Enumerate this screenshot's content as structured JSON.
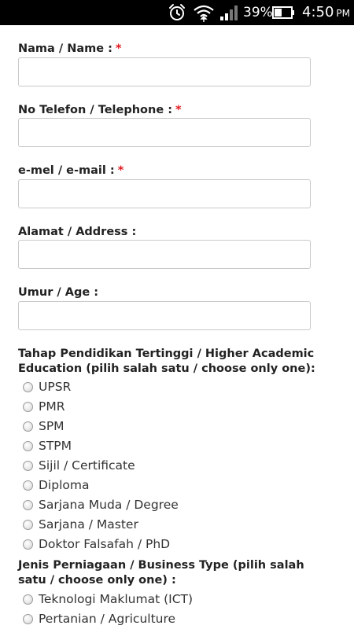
{
  "status_bar": {
    "battery_percent": "39%",
    "time": "4:50",
    "am_pm": "PM",
    "icons": [
      "alarm-icon",
      "wifi-icon",
      "signal-icon",
      "battery-icon"
    ]
  },
  "colors": {
    "required_star": "#e3171d",
    "label_text": "#222222",
    "input_border": "#c9c9c9"
  },
  "fields": [
    {
      "label": "Nama / Name :",
      "required": "*",
      "value": ""
    },
    {
      "label": "No Telefon / Telephone :",
      "required": "*",
      "value": ""
    },
    {
      "label": "e-mel / e-mail :",
      "required": "*",
      "value": ""
    },
    {
      "label": "Alamat / Address :",
      "value": ""
    },
    {
      "label": "Umur / Age :",
      "value": ""
    }
  ],
  "education": {
    "title": "Tahap Pendidikan Tertinggi / Higher Academic Education (pilih salah satu / choose only one):",
    "options": [
      "UPSR",
      "PMR",
      "SPM",
      "STPM",
      "Sijil / Certificate",
      "Diploma",
      "Sarjana Muda / Degree",
      "Sarjana / Master",
      "Doktor Falsafah / PhD"
    ]
  },
  "business": {
    "title": "Jenis Perniagaan / Business Type (pilih salah satu / choose only one) :",
    "options": [
      "Teknologi Maklumat (ICT)",
      "Pertanian / Agriculture"
    ]
  }
}
